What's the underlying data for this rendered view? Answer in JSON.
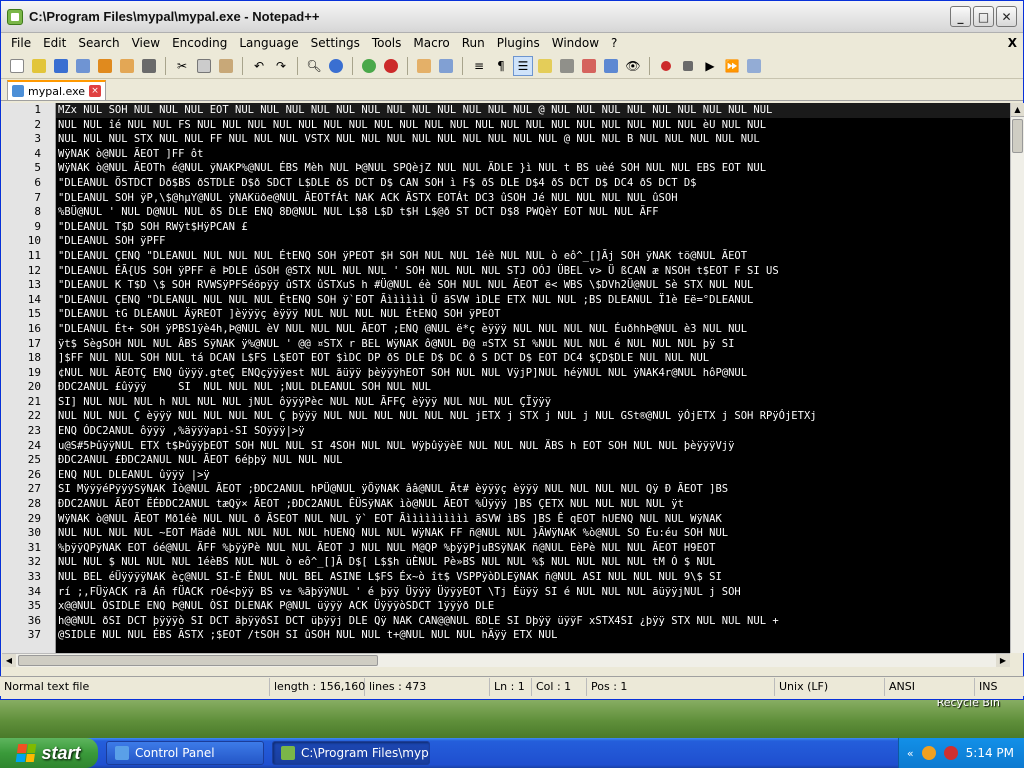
{
  "window": {
    "title": "C:\\Program Files\\mypal\\mypal.exe - Notepad++",
    "min": "_",
    "max": "□",
    "close": "✕"
  },
  "menu": [
    "File",
    "Edit",
    "Search",
    "View",
    "Encoding",
    "Language",
    "Settings",
    "Tools",
    "Macro",
    "Run",
    "Plugins",
    "Window",
    "?"
  ],
  "menu_close": "X",
  "toolbar": {
    "icons": [
      "new-file-icon",
      "open-file-icon",
      "save-icon",
      "save-all-icon",
      "close-icon",
      "close-all-icon",
      "print-icon",
      "cut-icon",
      "copy-icon",
      "paste-icon",
      "undo-icon",
      "redo-icon",
      "find-icon",
      "replace-icon",
      "zoom-in-icon",
      "zoom-out-icon",
      "sync-vertical-icon",
      "sync-horizontal-icon",
      "word-wrap-icon",
      "show-all-chars-icon",
      "indent-guide-icon",
      "doc-map-icon",
      "function-list-icon",
      "folder-workspace-icon",
      "monitor-icon",
      "view-icon",
      "record-macro-icon",
      "stop-record-icon",
      "play-macro-icon",
      "run-macro-multiple-icon",
      "save-macro-icon"
    ],
    "colors": {
      "blue": "#3a6fd1",
      "green": "#4aa84a",
      "red": "#cc2a2a",
      "orange": "#e08a1e",
      "gray": "#6a6a6a",
      "yellow": "#e2c53a"
    }
  },
  "tab": {
    "label": "mypal.exe"
  },
  "editor": {
    "line_numbers": [
      "1",
      "2",
      "3",
      "4",
      "5",
      "6",
      "7",
      "8",
      "9",
      "10",
      "11",
      "12",
      "13",
      "14",
      "15",
      "16",
      "17",
      "18",
      "19",
      "20",
      "21",
      "22",
      "23",
      "24",
      "25",
      "26",
      "27",
      "28",
      "29",
      "30",
      "31",
      "32",
      "33",
      "34",
      "35",
      "36",
      "37"
    ],
    "lines": [
      "MZx NUL SOH NUL NUL NUL EOT NUL NUL NUL NUL NUL NUL NUL NUL NUL NUL NUL NUL @ NUL NUL NUL NUL NUL NUL NUL NUL NUL",
      "NUL NUL îé NUL NUL FS NUL NUL NUL NUL NUL NUL NUL NUL NUL NUL NUL NUL NUL NUL NUL NUL NUL NUL NUL NUL èU NUL NUL",
      "NUL NUL NUL STX NUL NUL FF NUL NUL NUL VSTX NUL NUL NUL NUL NUL NUL NUL NUL NUL @ NUL NUL B NUL NUL NUL NUL NUL",
      "WÿNAK ò@NUL ÃEOT ]FF ôt",
      "WÿNAK ò@NUL ÃEOTh é@NUL ÿNAKP%@NUL ÉBS Mèh NUL Þ@NUL SPQèjZ NUL NUL ÄDLE }ì NUL t BS uèé SOH NUL NUL EBS EOT NUL",
      "\"DLEANUL ÕSTDCT Dð$BS ðSTDLE D$ð SDCT L$DLE ðS DCT D$ CAN SOH ì F$ ðS DLE D$4 ðS DCT D$ DC4 ðS DCT D$",
      "\"DLEANUL SOH ÿP,\\$@hµY@NUL ÿNAKüðe@NUL ÃEOTfÁt NAK ACK ÃSTX EOTÁt DC3 ûSOH Jé NUL NUL NUL NUL ûSOH",
      "%BÜ@NUL ' NUL D@NUL NUL ðS DLE ENQ 8Ð@NUL NUL L$8 L$D t$H L$@ð ST DCT D$8 PWQèY EOT NUL NUL ÃFF",
      "\"DLEANUL T$D SOH RWÿt$HÿPCAN £",
      "\"DLEANUL SOH ÿPFF",
      "\"DLEANUL ÇENQ \"DLEANUL NUL NUL NUL ÉtENQ SOH ÿPEOT $H SOH NUL NUL 1éè NUL NUL ò eô^_[]Ãj SOH ÿNAK tö@NUL ÃEOT",
      "\"DLEANUL ÉÃ{US SOH ÿPFF ë ÞDLE ûSOH @STX NUL NUL NUL ' SOH NUL NUL NUL STJ OÓJ ÜBEL v> Ü ßCAN æ NSOH t$EOT F SI US",
      "\"DLEANUL K T$D \\$ SOH RVWSÿPFSéöpÿÿ ûSTX ûSTXuS h #Ü@NUL éè SOH NUL NUL ÃEOT ë< WBS \\$DVh2Ü@NUL Sè STX NUL NUL",
      "\"DLEANUL ÇENQ \"DLEANUL NUL NUL NUL ÉtENQ SOH ÿ`EOT Ãìììììì Ü ãSVW ìDLE ETX NUL NUL ;BS DLEANUL Ï1è Eë=°DLEANUL",
      "\"DLEANUL tG DLEANUL ÄÿREOT ]èÿÿÿç èÿÿÿ NUL NUL NUL NUL ÉtENQ SOH ÿPEOT",
      "\"DLEANUL Ét+ SOH ÿPBS1ÿè4h,Þ@NUL èV NUL NUL NUL ÃEOT ;ENQ @NUL ë*ç èÿÿÿ NUL NUL NUL NUL ÉuðhhÞ@NUL è3 NUL NUL",
      "ÿt$ SègSOH NUL NUL ÂBS SÿNAK ÿ%@NUL ' @@ ¤STX r BEL WÿNAK ô@NUL Ð@ ¤STX SI %NUL NUL NUL é NUL NUL NUL þÿ SI",
      "]$FF NUL NUL SOH NUL tá DCAN L$FS L$EOT EOT $ìDC DP ðS DLE D$ DC ð S DCT D$ EOT DC4 $ÇD$DLE NUL NUL NUL",
      "¢NUL NUL ÃEOTÇ ENQ ûÿÿÿ.gteÇ ENQçÿÿÿest NUL ãüÿÿ þèÿÿÿhEOT SOH NUL NUL VÿjP]NUL héÿNUL NUL ÿNAK4r@NUL hôP@NUL",
      "ÐDC2ANUL £ûÿÿÿ     SI  NUL NUL NUL ;NUL DLEANUL SOH NUL NUL",
      "SI] NUL NUL NUL h NUL NUL NUL jNUL ôÿÿÿPèc NUL NUL ÃFFÇ èÿÿÿ NUL NUL NUL ÇÏÿÿÿ",
      "NUL NUL NUL Ç èÿÿÿ NUL NUL NUL NUL Ç þÿÿÿ NUL NUL NUL NUL NUL NUL jETX j STX j NUL j NUL GSt®@NUL ÿÓjETX j SOH RPÿÓjETXj",
      "ENQ ÓDC2ANUL ôÿÿÿ ,%äÿÿÿapi-SI SOÿÿÿ|>ÿ",
      "u@S#5ÞûÿÿNUL ETX t$ÞûÿÿþEOT SOH NUL NUL SI 4SOH NUL NUL WÿþûÿÿèE NUL NUL NUL ÄBS h EOT SOH NUL NUL þèÿÿÿVjÿ",
      "ÐDC2ANUL £ÐDC2ANUL NUL ÃEOT 6éþþÿ NUL NUL NUL",
      "ENQ NUL DLEANUL ûÿÿÿ |>ÿ",
      "SI MÿÿÿéPÿÿÿSÿNAK Ìò@NUL ÃEOT ;ÐDC2ANUL hPÜ@NUL ÿÖÿNAK ââ@NUL Ãt# èÿÿÿç èÿÿÿ NUL NUL NUL NUL Qÿ Ð ÃEOT ]BS",
      "ÐDC2ANUL ÃEOT ËÉÐDC2ANUL tæQÿ× ÃEOT ;ÐDC2ANUL ÊÜSÿNAK ìò@NUL ÃEOT %Ûÿÿÿ ]BS ÇETX NUL NUL NUL NUL ÿt",
      "WÿNAK ò@NUL ÃEOT Mð1éè NUL NUL ð ÃSEOT NUL NUL ÿ` EOT Ãìììììììììì ãSVW ìBS ]BS Ê qEOT hUENQ NUL NUL WÿNAK",
      "NUL NUL NUL NUL ~EOT Mädê NUL NUL NUL NUL hUENQ NUL NUL WÿNAK FF ñ@NUL NUL }ÃWÿNAK %ò@NUL SO Éu:éu SOH NUL",
      "%þÿÿQPÿNAK EOT óé@NUL ÃFF %þÿÿPè NUL NUL ÃEOT J NUL NUL M@QP %þÿÿPjuBSÿNAK ñ@NUL EèPè NUL NUL ÃEOT H9EOT",
      "NUL NUL $ NUL NUL NUL 1éèBS NUL NUL ò eô^_[]Ã D$[ L$$h üÈNUL Pè»BS NUL NUL %$ NUL NUL NUL NUL tM Ó $ NUL",
      "NUL BEL éÜÿÿÿÿNAK èç@NUL SI-È ÊNUL NUL BEL ASINE L$FS Éx~ò ît$ VSPPÿòDLEÿNAK ñ@NUL ASI NUL NUL NUL 9\\$ SI",
      "rí ;,FÜÿACK rã Áñ fÜACK rOé<þÿÿ BS v± %ãþÿÿNUL ' é þÿÿ Üÿÿÿ ÜÿÿÿEOT \\Tj Èüÿÿ SI é NUL NUL NUL ãüÿÿjNUL j SOH",
      "x@@NUL ÒSIDLE ENQ Þ@NUL ÒSI DLENAK P@NUL üÿÿÿ ACK ÜÿÿÿòSDCT 1ÿÿÿð DLE",
      "h@@NUL ðSI DCT þÿÿÿò SI DCT ãþÿÿðSI DCT üþÿÿj DLE Qÿ NAK CAN@@NUL ßDLE SI Dþÿÿ üÿÿF xSTX4SI ¿þÿÿ STX NUL NUL NUL +",
      "@SIDLE NUL NUL ÉBS ÃSTX ;$EOT /tSOH SI ûSOH NUL NUL t+@NUL NUL NUL hÄÿÿ ETX NUL"
    ]
  },
  "status": {
    "type": "Normal text file",
    "length": "length : 156,160",
    "lines": "lines : 473",
    "ln": "Ln : 1",
    "col": "Col : 1",
    "pos": "Pos : 1",
    "eol": "Unix (LF)",
    "encoding": "ANSI",
    "ins": "INS"
  },
  "desktop": {
    "label": "Recycle Bin"
  },
  "taskbar": {
    "start": "start",
    "tasks": [
      {
        "label": "Control Panel",
        "active": false
      },
      {
        "label": "C:\\Program Files\\myp...",
        "active": true
      }
    ],
    "tray_chevron": "«",
    "clock": "5:14 PM"
  }
}
